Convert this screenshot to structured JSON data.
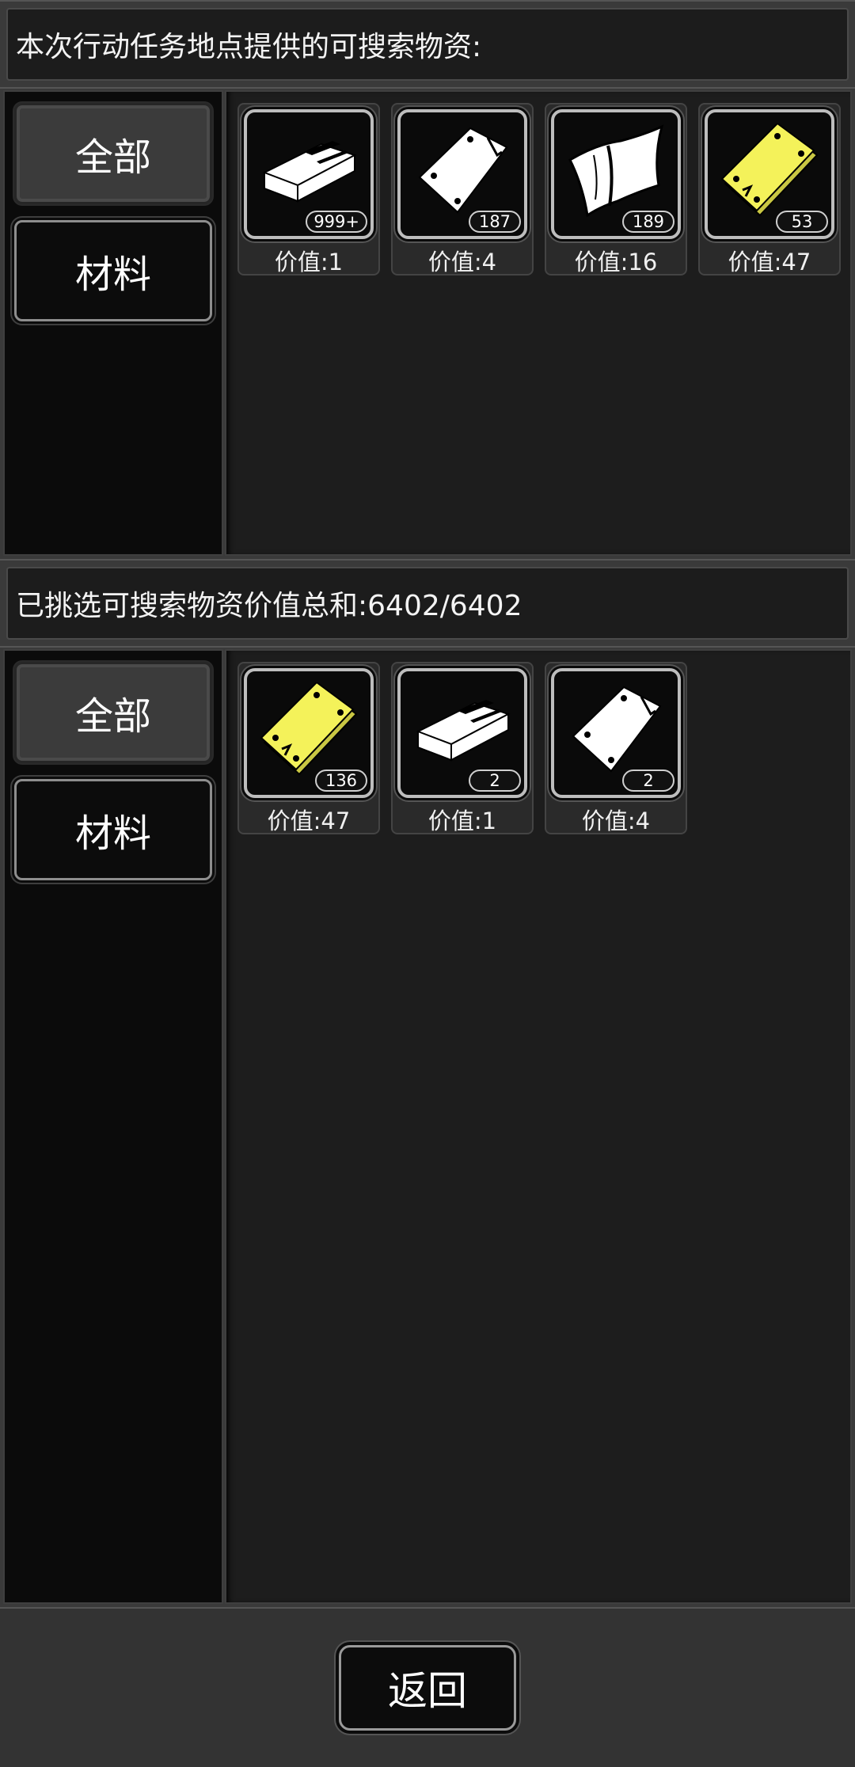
{
  "top_section": {
    "header": "本次行动任务地点提供的可搜索物资:",
    "tabs": [
      {
        "label": "全部",
        "state": "active"
      },
      {
        "label": "材料",
        "state": "inactive"
      }
    ],
    "items": [
      {
        "icon": "steel-bar-icon",
        "qty": "999+",
        "value": "价值:1",
        "color": "#ffffff"
      },
      {
        "icon": "metal-sheet-icon",
        "qty": "187",
        "value": "价值:4",
        "color": "#ffffff"
      },
      {
        "icon": "cloth-icon",
        "qty": "189",
        "value": "价值:16",
        "color": "#ffffff"
      },
      {
        "icon": "gold-plate-icon",
        "qty": "53",
        "value": "价值:47",
        "color": "#f4f25a"
      }
    ]
  },
  "bottom_section": {
    "header": "已挑选可搜索物资价值总和:6402/6402",
    "tabs": [
      {
        "label": "全部",
        "state": "active"
      },
      {
        "label": "材料",
        "state": "inactive"
      }
    ],
    "items": [
      {
        "icon": "gold-plate-icon",
        "qty": "136",
        "value": "价值:47",
        "color": "#f4f25a"
      },
      {
        "icon": "steel-bar-icon",
        "qty": "2",
        "value": "价值:1",
        "color": "#ffffff"
      },
      {
        "icon": "metal-sheet-icon",
        "qty": "2",
        "value": "价值:4",
        "color": "#ffffff"
      }
    ]
  },
  "footer": {
    "back_label": "返回"
  }
}
